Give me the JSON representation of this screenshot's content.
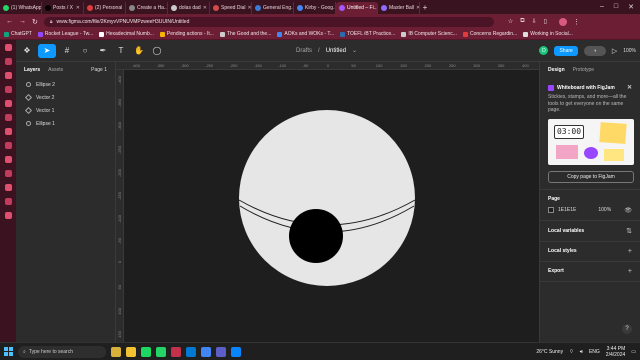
{
  "browser": {
    "tabs": [
      {
        "label": "(1) WhatsApp",
        "color": "#25d366",
        "active": false
      },
      {
        "label": "Posts / X",
        "color": "#000000",
        "active": false
      },
      {
        "label": "(2) Personal",
        "color": "#e03c3c",
        "active": false
      },
      {
        "label": "Create a Ha...",
        "color": "#888888",
        "active": false
      },
      {
        "label": "dolas dad",
        "color": "#cccccc",
        "active": false
      },
      {
        "label": "Speed Dial",
        "color": "#d24b4b",
        "active": false
      },
      {
        "label": "General Eng...",
        "color": "#3a7bd5",
        "active": false
      },
      {
        "label": "Kirby - Goog...",
        "color": "#4285f4",
        "active": false
      },
      {
        "label": "Untitled – Fi...",
        "color": "#a259ff",
        "active": true
      },
      {
        "label": "Master Ball",
        "color": "#8c6cff",
        "active": false
      }
    ],
    "url": "www.figma.com/file/2KmyvVPNUVMPzweeH3UUIN/Untitled",
    "bookmarks": [
      {
        "label": "ChatGPT",
        "color": "#10a37f"
      },
      {
        "label": "Rocket League - Tw...",
        "color": "#9146ff"
      },
      {
        "label": "Hexadecimal Numb...",
        "color": "#ffffff"
      },
      {
        "label": "Pending actions - It...",
        "color": "#f4b400"
      },
      {
        "label": "The Good and the...",
        "color": "#cccccc"
      },
      {
        "label": "AOKs and WOKs - T...",
        "color": "#4285f4"
      },
      {
        "label": "TOEFL iBT Practice...",
        "color": "#2b6cb0"
      },
      {
        "label": "IB Computer Scienc...",
        "color": "#cccccc"
      },
      {
        "label": "Concerns Regardin...",
        "color": "#e03c3c"
      },
      {
        "label": "Working in Social...",
        "color": "#dddddd"
      }
    ]
  },
  "figma": {
    "breadcrumb_folder": "Drafts",
    "breadcrumb_sep": "/",
    "file_name": "Untitled",
    "avatar_letter": "D",
    "share_label": "Share",
    "zoom_label": "100%",
    "layers_tab": "Layers",
    "assets_tab": "Assets",
    "page_selector": "Page 1",
    "layers": [
      {
        "name": "Ellipse 2",
        "kind": "ellipse"
      },
      {
        "name": "Vector 2",
        "kind": "vector"
      },
      {
        "name": "Vector 1",
        "kind": "vector"
      },
      {
        "name": "Ellipse 1",
        "kind": "ellipse"
      }
    ],
    "ruler_top": [
      "-400",
      "-350",
      "-300",
      "-250",
      "-200",
      "-150",
      "-100",
      "-50",
      "0",
      "50",
      "100",
      "150",
      "200",
      "250",
      "300",
      "350",
      "400"
    ],
    "ruler_left": [
      "-400",
      "-350",
      "-300",
      "-250",
      "-200",
      "-150",
      "-100",
      "-50",
      "0",
      "50",
      "100",
      "150"
    ],
    "design_tab": "Design",
    "prototype_tab": "Prototype",
    "promo_title": "Whiteboard with FigJam",
    "promo_body": "Stickies, stamps, and more—all the tools to get everyone on the same page.",
    "promo_clock": "03:00",
    "copy_button": "Copy page to FigJam",
    "page_section": "Page",
    "page_color": "1E1E1E",
    "page_opacity": "100%",
    "local_variables": "Local variables",
    "local_styles": "Local styles",
    "export": "Export",
    "canvas_colors": {
      "background": "#1e1e1e",
      "ball": "#e6e6e6",
      "center": "#000000",
      "lines": "#1e1e1e"
    }
  },
  "taskbar": {
    "search_placeholder": "Type here to search",
    "weather": "26°C  Sunny",
    "lang": "ENG",
    "time": "3:44 PM",
    "date": "2/4/2024"
  }
}
